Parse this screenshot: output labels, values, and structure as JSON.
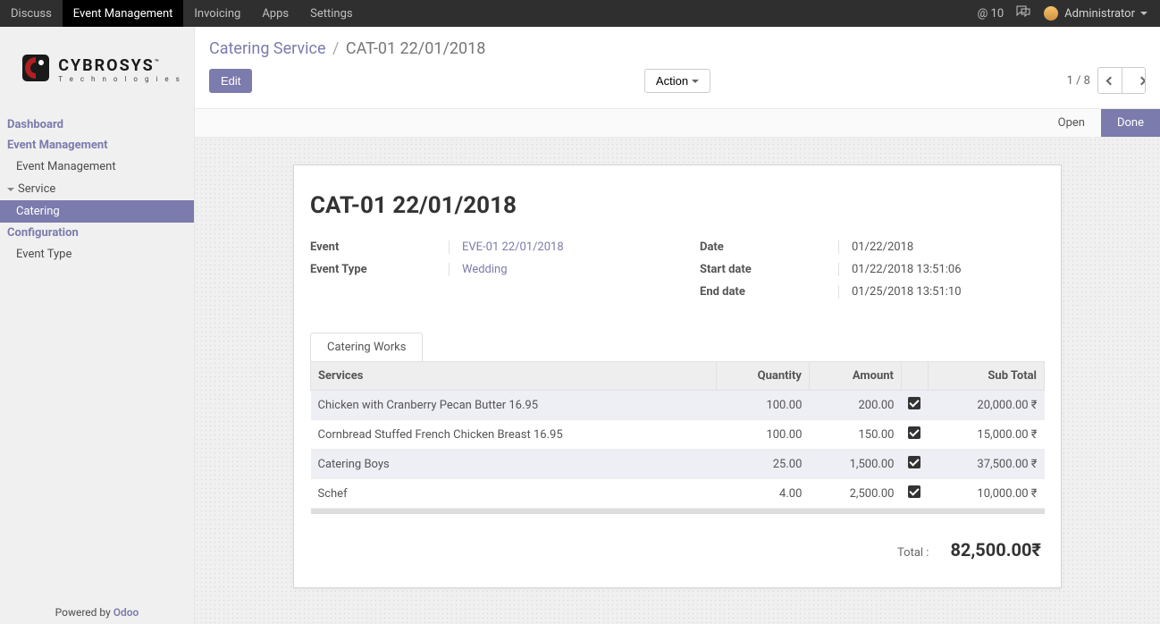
{
  "nav": {
    "items": [
      "Discuss",
      "Event Management",
      "Invoicing",
      "Apps",
      "Settings"
    ],
    "active_index": 1,
    "msg_badge": "@ 10",
    "user": "Administrator"
  },
  "logo": {
    "name": "CYBROSYS",
    "sub": "Technologies",
    "tm": "™"
  },
  "sidebar": {
    "items": [
      {
        "label": "Dashboard",
        "type": "head"
      },
      {
        "label": "Event Management",
        "type": "head"
      },
      {
        "label": "Event Management",
        "type": "item"
      },
      {
        "label": "Service",
        "type": "parent"
      },
      {
        "label": "Catering",
        "type": "item",
        "active": true
      },
      {
        "label": "Configuration",
        "type": "head"
      },
      {
        "label": "Event Type",
        "type": "item"
      }
    ],
    "powered": "Powered by ",
    "odoo": "Odoo"
  },
  "breadcrumb": {
    "root": "Catering Service",
    "sep": "/",
    "current": "CAT-01 22/01/2018"
  },
  "toolbar": {
    "edit": "Edit",
    "action": "Action",
    "pager": "1 / 8"
  },
  "status": {
    "open": "Open",
    "done": "Done",
    "active": "done"
  },
  "record": {
    "title": "CAT-01 22/01/2018",
    "fields_left": [
      {
        "label": "Event",
        "value": "EVE-01 22/01/2018",
        "link": true
      },
      {
        "label": "Event Type",
        "value": "Wedding",
        "link": true
      }
    ],
    "fields_right": [
      {
        "label": "Date",
        "value": "01/22/2018"
      },
      {
        "label": "Start date",
        "value": "01/22/2018 13:51:06"
      },
      {
        "label": "End date",
        "value": "01/25/2018 13:51:10"
      }
    ]
  },
  "tab_label": "Catering Works",
  "table": {
    "headers": [
      "Services",
      "Quantity",
      "Amount",
      "",
      "Sub Total"
    ],
    "rows": [
      {
        "service": "Chicken with Cranberry Pecan Butter 16.95",
        "qty": "100.00",
        "amount": "200.00",
        "checked": true,
        "subtotal": "20,000.00 ₹"
      },
      {
        "service": "Cornbread Stuffed French Chicken Breast 16.95",
        "qty": "100.00",
        "amount": "150.00",
        "checked": true,
        "subtotal": "15,000.00 ₹"
      },
      {
        "service": "Catering Boys",
        "qty": "25.00",
        "amount": "1,500.00",
        "checked": true,
        "subtotal": "37,500.00 ₹"
      },
      {
        "service": "Schef",
        "qty": "4.00",
        "amount": "2,500.00",
        "checked": true,
        "subtotal": "10,000.00 ₹"
      }
    ]
  },
  "total": {
    "label": "Total :",
    "value": "82,500.00₹"
  },
  "chart_data": {
    "type": "table",
    "title": "Catering Works",
    "columns": [
      "Services",
      "Quantity",
      "Amount",
      "Sub Total"
    ],
    "rows": [
      [
        "Chicken with Cranberry Pecan Butter 16.95",
        100.0,
        200.0,
        20000.0
      ],
      [
        "Cornbread Stuffed French Chicken Breast 16.95",
        100.0,
        150.0,
        15000.0
      ],
      [
        "Catering Boys",
        25.0,
        1500.0,
        37500.0
      ],
      [
        "Schef",
        4.0,
        2500.0,
        10000.0
      ]
    ],
    "currency": "₹",
    "total": 82500.0
  }
}
